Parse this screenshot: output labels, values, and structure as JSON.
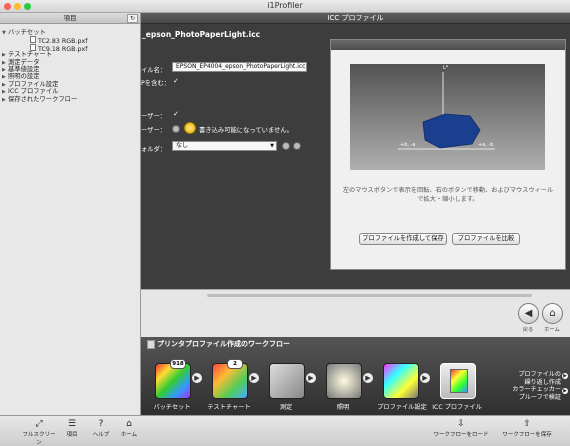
{
  "window": {
    "title": "i1Profiler"
  },
  "sidebar": {
    "header": "項目",
    "refresh_glyph": "↻",
    "items": [
      {
        "label": "バッチセット",
        "expanded": true,
        "level": 0
      },
      {
        "label": "TC2.83 RGB.pxf",
        "level": 2
      },
      {
        "label": "TC9.18 RGB.pxf",
        "level": 2
      },
      {
        "label": "テストチャート",
        "level": 0
      },
      {
        "label": "測定データ",
        "level": 0
      },
      {
        "label": "基準値設定",
        "level": 0
      },
      {
        "label": "照明の設定",
        "level": 0
      },
      {
        "label": "プロファイル設定",
        "level": 0
      },
      {
        "label": "ICC プロファイル",
        "level": 0
      },
      {
        "label": "保存されたワークフロー",
        "level": 0
      }
    ]
  },
  "main": {
    "header": "ICC プロファイル",
    "profile_name": "_epson_PhotoPaperLight.icc",
    "fields": {
      "filename_label": "イル名：",
      "filename_value": "EPSON_EP4004_epson_PhotoPaperLight.icc",
      "include_label": "Pを含む：",
      "user1_label": "ーザー：",
      "user2_label": "ーザー：",
      "warning_text": "書き込み可能になっていません。",
      "folder_label": "ォルダ：",
      "folder_value": "なし",
      "check_glyph": "✓"
    },
    "preview": {
      "axis_l": "L*",
      "axis_left": "+b, -a",
      "axis_right": "+a, -b",
      "help_text": "左のマウスボタンで表示を回転、右のボタンで移動、およびマウスウィールで拡大・縮小します。",
      "save_button": "プロファイルを作成して保存",
      "compare_button": "プロファイルを比較"
    },
    "nav": {
      "back_label": "戻る",
      "home_label": "ホーム",
      "back_glyph": "◀",
      "home_glyph": "⌂"
    }
  },
  "workflow": {
    "title": "プリンタプロファイル作成のワークフロー",
    "steps": [
      {
        "label": "バッチセット",
        "badge": "918"
      },
      {
        "label": "テストチャート",
        "badge": "2"
      },
      {
        "label": "測定",
        "badge": ""
      },
      {
        "label": "照明",
        "badge": ""
      },
      {
        "label": "プロファイル設定",
        "badge": ""
      },
      {
        "label": "ICC プロファイル",
        "badge": ""
      }
    ],
    "arrow_glyph": "▶",
    "side_text": [
      "プロファイルの",
      "繰り返し作成",
      "カラーチェッカー",
      "プルーフで検証"
    ]
  },
  "bottom": {
    "fullscreen": "フルスクリーン",
    "items": "項目",
    "help": "ヘルプ",
    "home": "ホーム",
    "load_workflow": "ワークフローをロード",
    "save_workflow": "ワークフローを保存",
    "glyphs": {
      "fullscreen": "⤢",
      "items": "☰",
      "help": "?",
      "home": "⌂",
      "load": "⇩",
      "save": "⇧"
    }
  },
  "colors": {
    "close": "#fc5f57",
    "minimize": "#fdbb2e",
    "zoom": "#28c840",
    "surface": "#1a3f8f"
  }
}
